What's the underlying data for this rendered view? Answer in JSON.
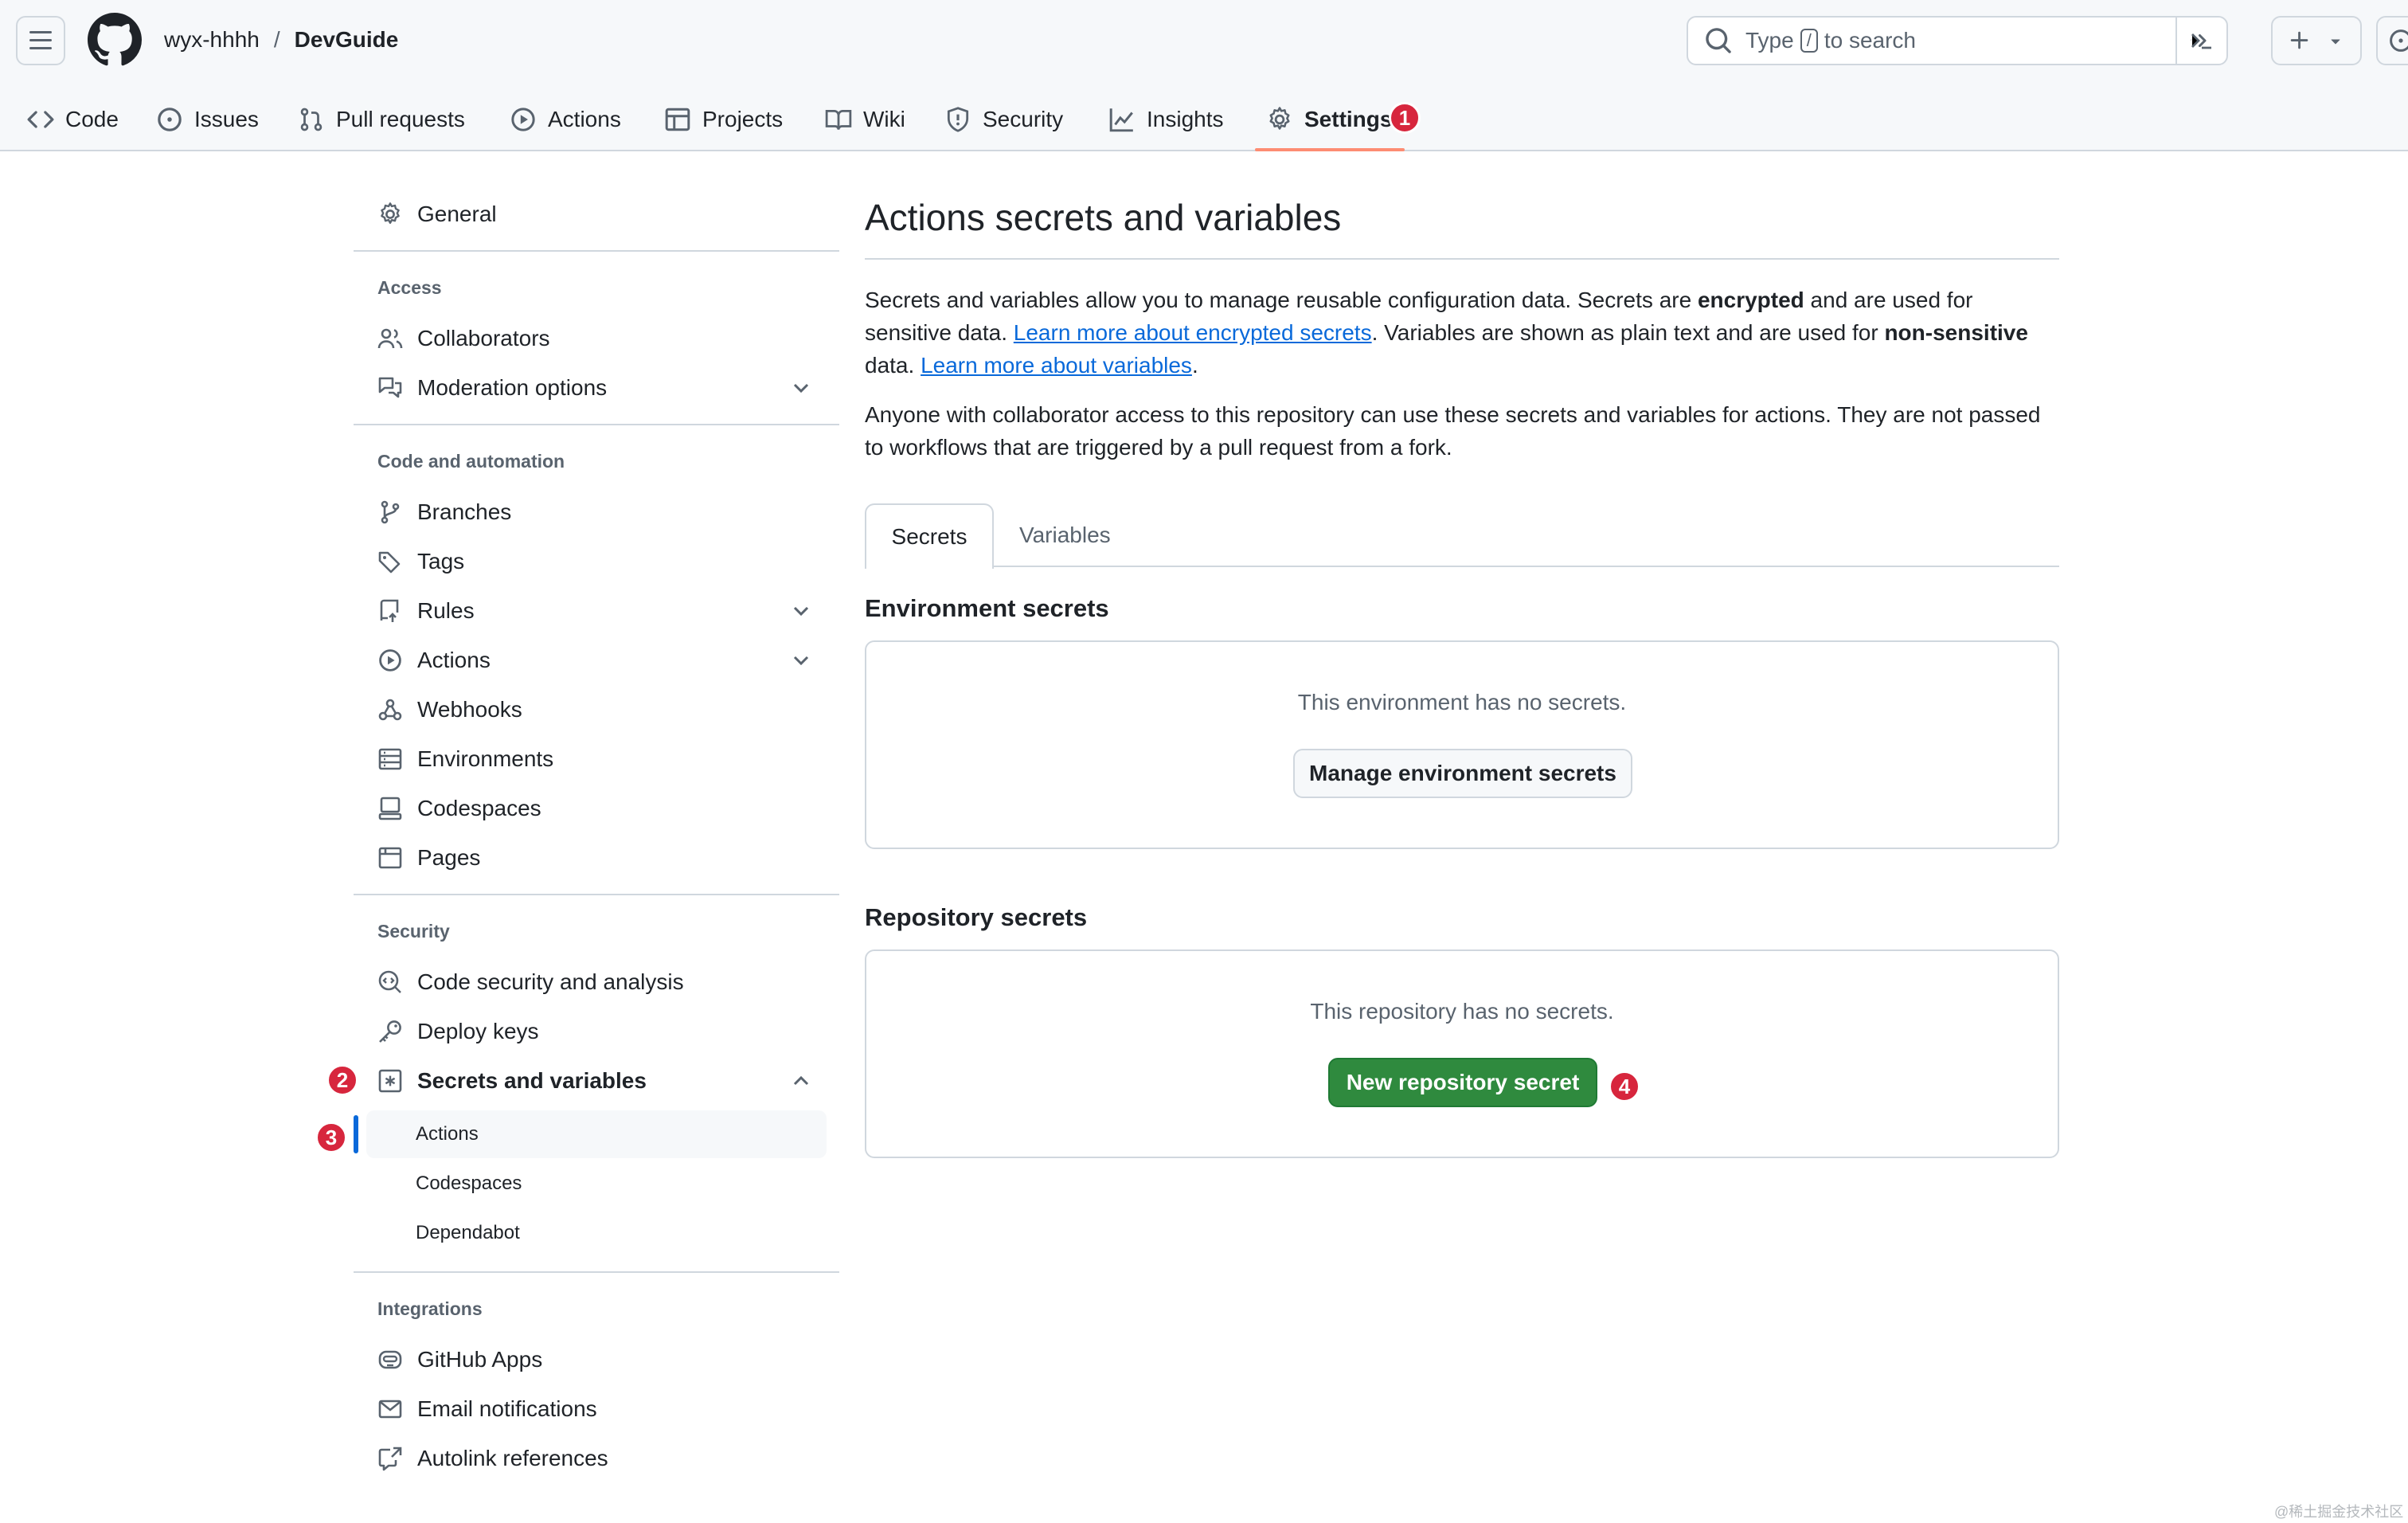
{
  "header": {
    "owner": "wyx-hhhh",
    "separator": "/",
    "repo": "DevGuide",
    "search": {
      "prefix": "Type",
      "key": "/",
      "suffix": "to search"
    }
  },
  "nav": {
    "items": [
      {
        "label": "Code",
        "icon": "code-icon"
      },
      {
        "label": "Issues",
        "icon": "issue-icon"
      },
      {
        "label": "Pull requests",
        "icon": "pull-request-icon"
      },
      {
        "label": "Actions",
        "icon": "play-icon"
      },
      {
        "label": "Projects",
        "icon": "table-icon"
      },
      {
        "label": "Wiki",
        "icon": "book-icon"
      },
      {
        "label": "Security",
        "icon": "shield-icon"
      },
      {
        "label": "Insights",
        "icon": "graph-icon"
      },
      {
        "label": "Settings",
        "icon": "gear-icon",
        "active": true
      }
    ]
  },
  "badges": [
    "1",
    "2",
    "3",
    "4"
  ],
  "sidebar": {
    "general": "General",
    "access_heading": "Access",
    "collaborators": "Collaborators",
    "moderation": "Moderation options",
    "code_heading": "Code and automation",
    "branches": "Branches",
    "tags": "Tags",
    "rules": "Rules",
    "actions": "Actions",
    "webhooks": "Webhooks",
    "environments": "Environments",
    "codespaces": "Codespaces",
    "pages": "Pages",
    "security_heading": "Security",
    "code_security": "Code security and analysis",
    "deploy_keys": "Deploy keys",
    "secrets": "Secrets and variables",
    "secrets_sub": [
      "Actions",
      "Codespaces",
      "Dependabot"
    ],
    "integrations_heading": "Integrations",
    "github_apps": "GitHub Apps",
    "email": "Email notifications",
    "autolink": "Autolink references"
  },
  "main": {
    "title": "Actions secrets and variables",
    "p1_a": "Secrets and variables allow you to manage reusable configuration data. Secrets are ",
    "p1_b": "encrypted",
    "p1_c": " and are used for sensitive data. ",
    "p1_link1": "Learn more about encrypted secrets",
    "p1_d": ". Variables are shown as plain text and are used for ",
    "p1_e": "non-sensitive",
    "p1_f": " data. ",
    "p1_link2": "Learn more about variables",
    "p1_g": ".",
    "p2": "Anyone with collaborator access to this repository can use these secrets and variables for actions. They are not passed to workflows that are triggered by a pull request from a fork.",
    "tabs": [
      "Secrets",
      "Variables"
    ],
    "env_title": "Environment secrets",
    "env_msg": "This environment has no secrets.",
    "env_button": "Manage environment secrets",
    "repo_title": "Repository secrets",
    "repo_msg": "This repository has no secrets.",
    "repo_button": "New repository secret"
  },
  "watermark": "@稀土掘金技术社区"
}
